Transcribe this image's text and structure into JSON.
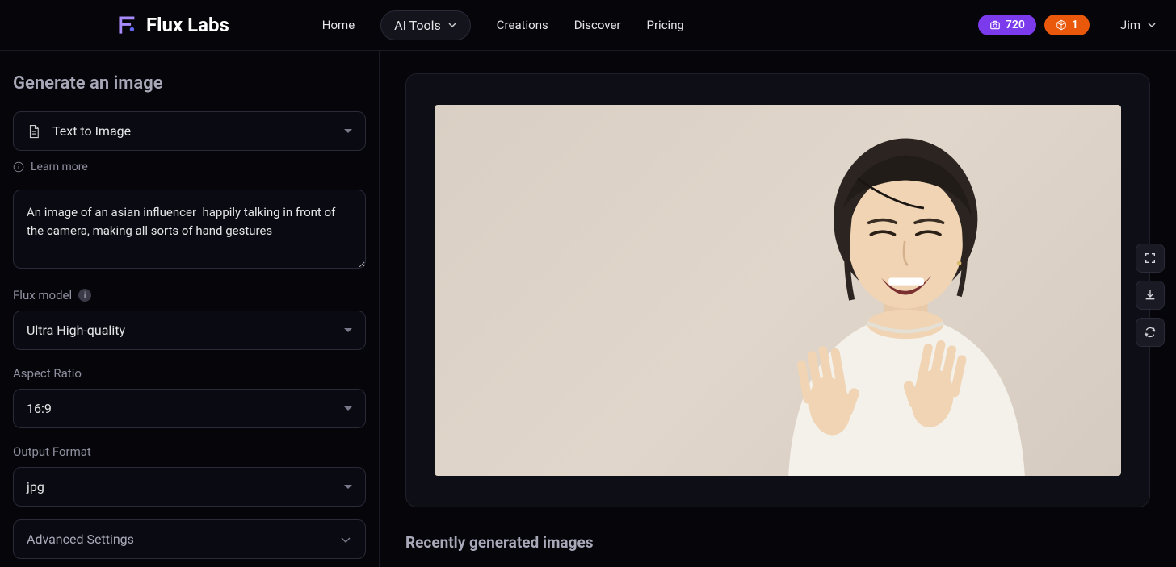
{
  "brand": "Flux Labs",
  "nav": {
    "home": "Home",
    "aitools": "AI Tools",
    "creations": "Creations",
    "discover": "Discover",
    "pricing": "Pricing"
  },
  "credits": {
    "purple": "720",
    "orange": "1"
  },
  "user": {
    "name": "Jim"
  },
  "sidebar": {
    "title": "Generate an image",
    "mode": "Text to Image",
    "learn_more": "Learn more",
    "prompt": "An image of an asian influencer  happily talking in front of the camera, making all sorts of hand gestures",
    "model_label": "Flux model",
    "model_value": "Ultra High-quality",
    "aspect_label": "Aspect Ratio",
    "aspect_value": "16:9",
    "format_label": "Output Format",
    "format_value": "jpg",
    "advanced": "Advanced Settings"
  },
  "main": {
    "recent_title": "Recently generated images"
  }
}
